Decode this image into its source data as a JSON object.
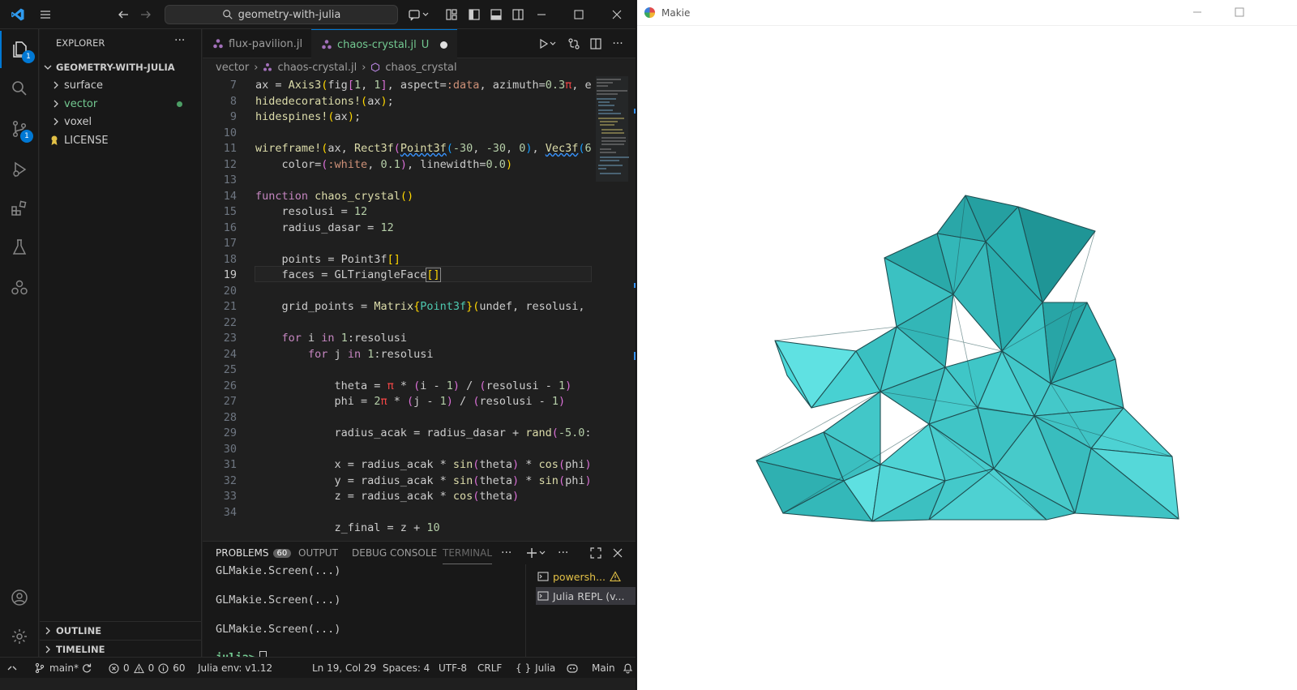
{
  "vscode": {
    "search_text": "geometry-with-julia",
    "explorer": {
      "title": "EXPLORER",
      "root": "GEOMETRY-WITH-JULIA",
      "items": [
        {
          "label": "surface"
        },
        {
          "label": "vector"
        },
        {
          "label": "voxel"
        },
        {
          "label": "LICENSE"
        }
      ],
      "outline": "OUTLINE",
      "timeline": "TIMELINE"
    },
    "activity_badges": {
      "explorer": "1",
      "scm": "1"
    },
    "tabs": [
      {
        "label": "flux-pavilion.jl"
      },
      {
        "label": "chaos-crystal.jl",
        "status": "U"
      }
    ],
    "breadcrumb": [
      "vector",
      "chaos-crystal.jl",
      "chaos_crystal"
    ],
    "code_line_numbers": [
      "7",
      "8",
      "9",
      "10",
      "11",
      "12",
      "13",
      "14",
      "15",
      "16",
      "17",
      "18",
      "19",
      "20",
      "21",
      "22",
      "23",
      "24",
      "25",
      "26",
      "27",
      "28",
      "29",
      "30",
      "31",
      "32",
      "33",
      "34"
    ],
    "panel": {
      "tabs": [
        "PROBLEMS",
        "OUTPUT",
        "DEBUG CONSOLE",
        "TERMINAL"
      ],
      "problems_count": "60",
      "terminal_lines": [
        "GLMakie.Screen(...)",
        "GLMakie.Screen(...)",
        "GLMakie.Screen(...)"
      ],
      "prompt": "julia>",
      "terminals": [
        "powersh...",
        "Julia REPL (v..."
      ]
    },
    "status": {
      "branch": "main*",
      "errors": "0",
      "warnings": "0",
      "info": "60",
      "julia_env": "Julia env: v1.12",
      "position": "Ln 19, Col 29",
      "spaces": "Spaces: 4",
      "encoding": "UTF-8",
      "eol": "CRLF",
      "language": "Julia",
      "branch_right": "Main"
    }
  },
  "makie": {
    "title": "Makie",
    "colors": {
      "crystal": "#3cc2c2",
      "edge": "#1f4f52"
    }
  }
}
